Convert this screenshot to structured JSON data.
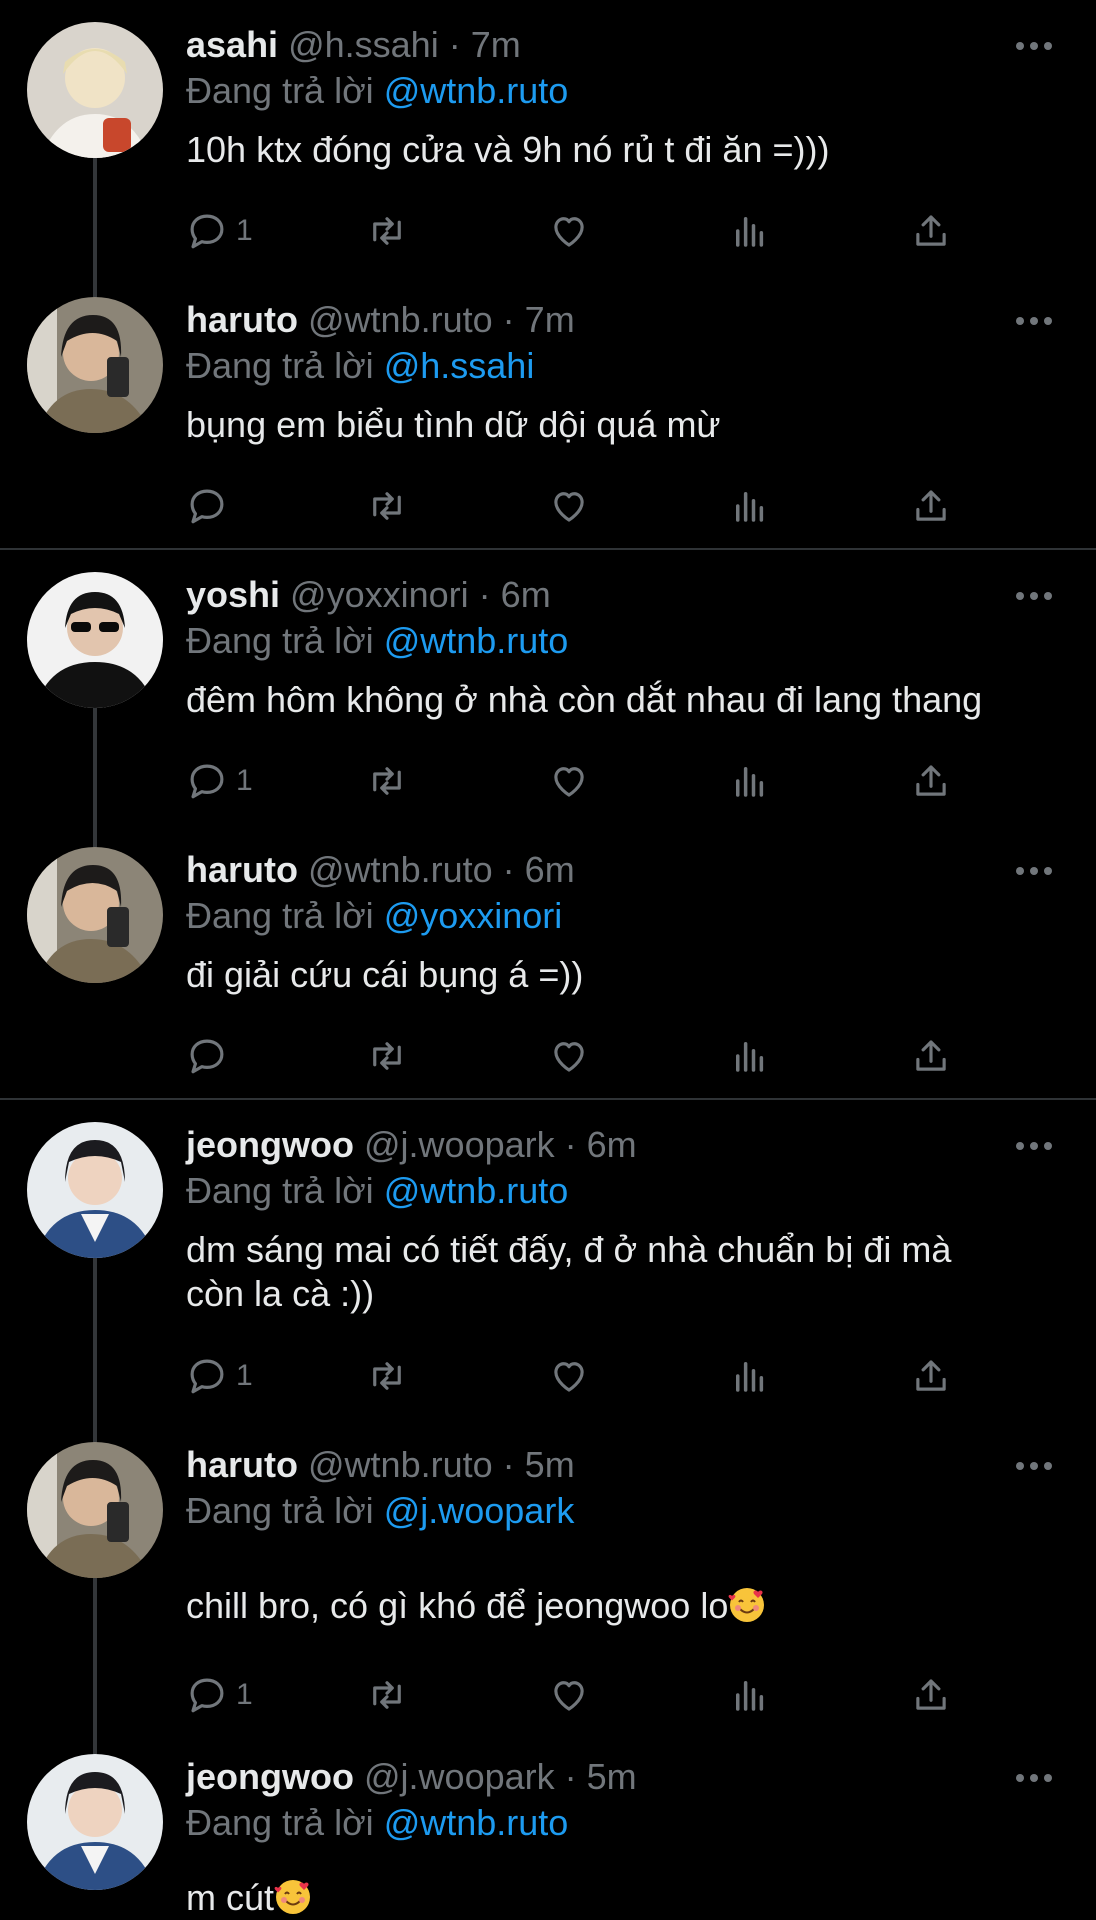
{
  "reply_prefix": "Đang trả lời",
  "colors": {
    "background": "#000000",
    "text": "#e7e9ea",
    "muted": "#71767b",
    "mention": "#1d9bf0",
    "thread_line": "#333639"
  },
  "tweets": [
    {
      "name": "asahi",
      "handle": "@h.ssahi",
      "sep": "·",
      "time": "7m",
      "reply_to": "@wtnb.ruto",
      "text": "10h ktx đóng cửa và 9h nó rủ t đi ăn =)))",
      "text2": "",
      "reply_count": "1",
      "avatar": "avatar-asahi"
    },
    {
      "name": "haruto",
      "handle": "@wtnb.ruto",
      "sep": "·",
      "time": "7m",
      "reply_to": "@h.ssahi",
      "text": "bụng em biểu tình dữ dội quá mừ",
      "text2": "",
      "reply_count": "",
      "avatar": "avatar-haruto"
    },
    {
      "name": "yoshi",
      "handle": "@yoxxinori",
      "sep": "·",
      "time": "6m",
      "reply_to": "@wtnb.ruto",
      "text": "đêm hôm không ở nhà còn dắt nhau đi lang thang",
      "text2": "",
      "reply_count": "1",
      "avatar": "avatar-yoshi"
    },
    {
      "name": "haruto",
      "handle": "@wtnb.ruto",
      "sep": "·",
      "time": "6m",
      "reply_to": "@yoxxinori",
      "text": "đi giải cứu cái bụng á =))",
      "text2": "",
      "reply_count": "",
      "avatar": "avatar-haruto"
    },
    {
      "name": "jeongwoo",
      "handle": "@j.woopark",
      "sep": "·",
      "time": "6m",
      "reply_to": "@wtnb.ruto",
      "text": "dm sáng mai có tiết đấy, đ ở nhà chuẩn bị đi mà",
      "text2": "còn la cà :))",
      "reply_count": "1",
      "avatar": "avatar-jeongwoo"
    },
    {
      "name": "haruto",
      "handle": "@wtnb.ruto",
      "sep": "·",
      "time": "5m",
      "reply_to": "@j.woopark",
      "text": "chill bro, có gì khó để jeongwoo lo",
      "text2": "",
      "emoji": "smiling-face-with-hearts",
      "reply_count": "1",
      "avatar": "avatar-haruto"
    },
    {
      "name": "jeongwoo",
      "handle": "@j.woopark",
      "sep": "·",
      "time": "5m",
      "reply_to": "@wtnb.ruto",
      "text": "m cút",
      "text2": "",
      "emoji": "smiling-face-with-hearts",
      "reply_count": "",
      "avatar": "avatar-jeongwoo"
    }
  ],
  "icons": {
    "reply": "reply-icon",
    "retweet": "retweet-icon",
    "like": "like-icon",
    "views": "views-icon",
    "share": "share-icon",
    "more": "more-icon"
  }
}
